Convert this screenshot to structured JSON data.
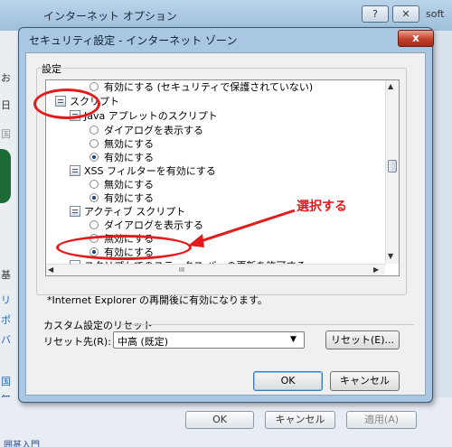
{
  "background_dialog": {
    "title": "インターネット オプション",
    "help_button": "?",
    "close_button": "✕",
    "right_fragment": "soft",
    "left_fragments": [
      "お",
      "日",
      "国",
      "基",
      "リ",
      "ポ",
      "バ",
      "国",
      "無"
    ],
    "bottom_buttons": [
      "OK",
      "キャンセル",
      "適用(A)"
    ],
    "bottom_text": "囲甚入門"
  },
  "dialog": {
    "title": "セキュリティ設定 - インターネット ゾーン",
    "close_label": "x",
    "settings_label": "設定",
    "note": "*Internet Explorer の再開後に有効になります。",
    "reset_section_label": "カスタム設定のリセット",
    "reset_to_label": "リセット先(R):",
    "reset_selected": "中高 (既定)",
    "reset_button": "リセット(E)...",
    "ok_button": "OK",
    "cancel_button": "キャンセル",
    "hscroll_grip": "III"
  },
  "settings_list": {
    "r0": "有効にする (セキュリティで保護されていない)",
    "r1": "スクリプト",
    "r2": "Java アプレットのスクリプト",
    "r3": "ダイアログを表示する",
    "r4": "無効にする",
    "r5": "有効にする",
    "r6": "XSS フィルターを有効にする",
    "r7": "無効にする",
    "r8": "有効にする",
    "r9": "アクティブ スクリプト",
    "r10": "ダイアログを表示する",
    "r11": "無効にする",
    "r12": "有効にする",
    "r13": "スクリプトでのステータス バーの更新を許可する"
  },
  "annotation": {
    "text": "選択する",
    "color": "#e41b1b"
  }
}
